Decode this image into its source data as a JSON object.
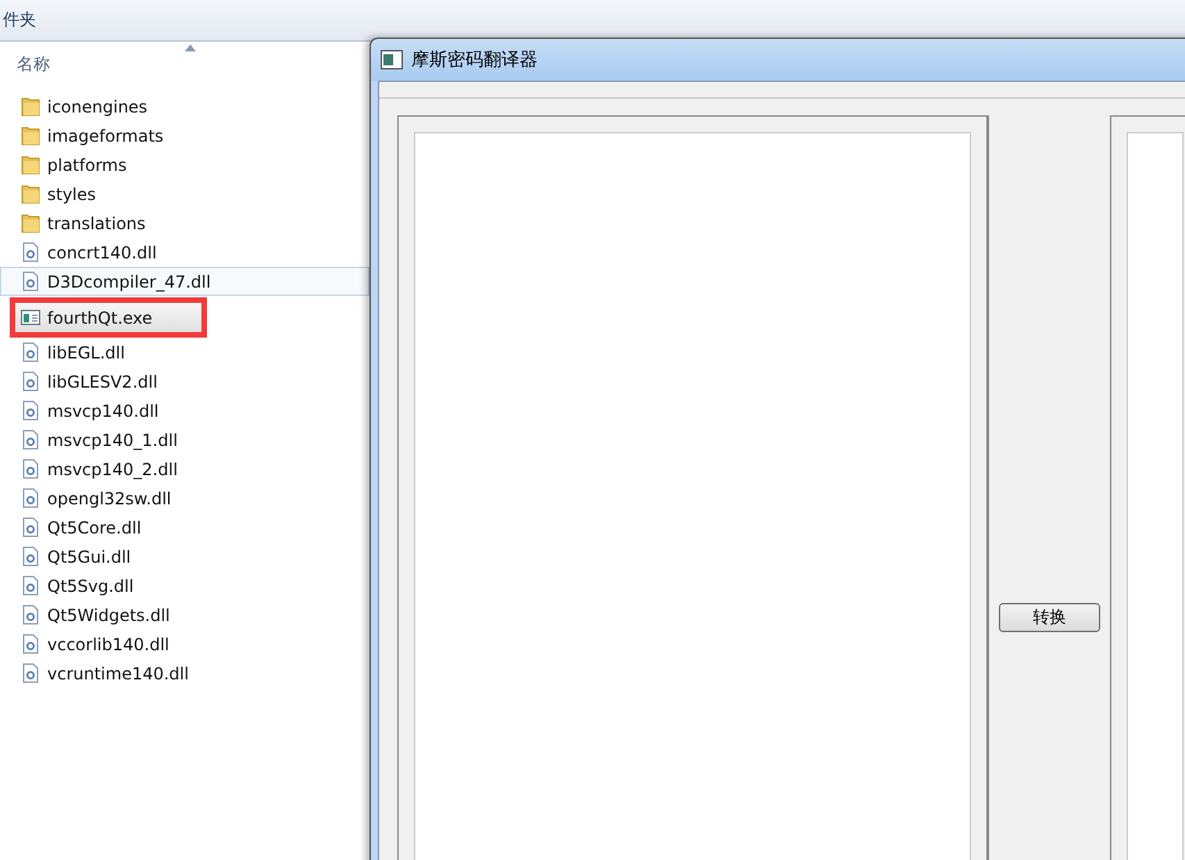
{
  "explorer": {
    "breadcrumb": "件夹",
    "column_header": "名称",
    "files": [
      {
        "name": "iconengines",
        "kind": "folder",
        "selected": false,
        "hovered": false,
        "marked": false
      },
      {
        "name": "imageformats",
        "kind": "folder",
        "selected": false,
        "hovered": false,
        "marked": false
      },
      {
        "name": "platforms",
        "kind": "folder",
        "selected": false,
        "hovered": false,
        "marked": false
      },
      {
        "name": "styles",
        "kind": "folder",
        "selected": false,
        "hovered": false,
        "marked": false
      },
      {
        "name": "translations",
        "kind": "folder",
        "selected": false,
        "hovered": false,
        "marked": false
      },
      {
        "name": "concrt140.dll",
        "kind": "dll",
        "selected": false,
        "hovered": false,
        "marked": false
      },
      {
        "name": "D3Dcompiler_47.dll",
        "kind": "dll",
        "selected": false,
        "hovered": true,
        "marked": false
      },
      {
        "name": "fourthQt.exe",
        "kind": "exe",
        "selected": true,
        "hovered": false,
        "marked": true
      },
      {
        "name": "libEGL.dll",
        "kind": "dll",
        "selected": false,
        "hovered": false,
        "marked": false
      },
      {
        "name": "libGLESV2.dll",
        "kind": "dll",
        "selected": false,
        "hovered": false,
        "marked": false
      },
      {
        "name": "msvcp140.dll",
        "kind": "dll",
        "selected": false,
        "hovered": false,
        "marked": false
      },
      {
        "name": "msvcp140_1.dll",
        "kind": "dll",
        "selected": false,
        "hovered": false,
        "marked": false
      },
      {
        "name": "msvcp140_2.dll",
        "kind": "dll",
        "selected": false,
        "hovered": false,
        "marked": false
      },
      {
        "name": "opengl32sw.dll",
        "kind": "dll",
        "selected": false,
        "hovered": false,
        "marked": false
      },
      {
        "name": "Qt5Core.dll",
        "kind": "dll",
        "selected": false,
        "hovered": false,
        "marked": false
      },
      {
        "name": "Qt5Gui.dll",
        "kind": "dll",
        "selected": false,
        "hovered": false,
        "marked": false
      },
      {
        "name": "Qt5Svg.dll",
        "kind": "dll",
        "selected": false,
        "hovered": false,
        "marked": false
      },
      {
        "name": "Qt5Widgets.dll",
        "kind": "dll",
        "selected": false,
        "hovered": false,
        "marked": false
      },
      {
        "name": "vccorlib140.dll",
        "kind": "dll",
        "selected": false,
        "hovered": false,
        "marked": false
      },
      {
        "name": "vcruntime140.dll",
        "kind": "dll",
        "selected": false,
        "hovered": false,
        "marked": false
      }
    ]
  },
  "dialog": {
    "title": "摩斯密码翻译器",
    "convert_button": "转换"
  }
}
